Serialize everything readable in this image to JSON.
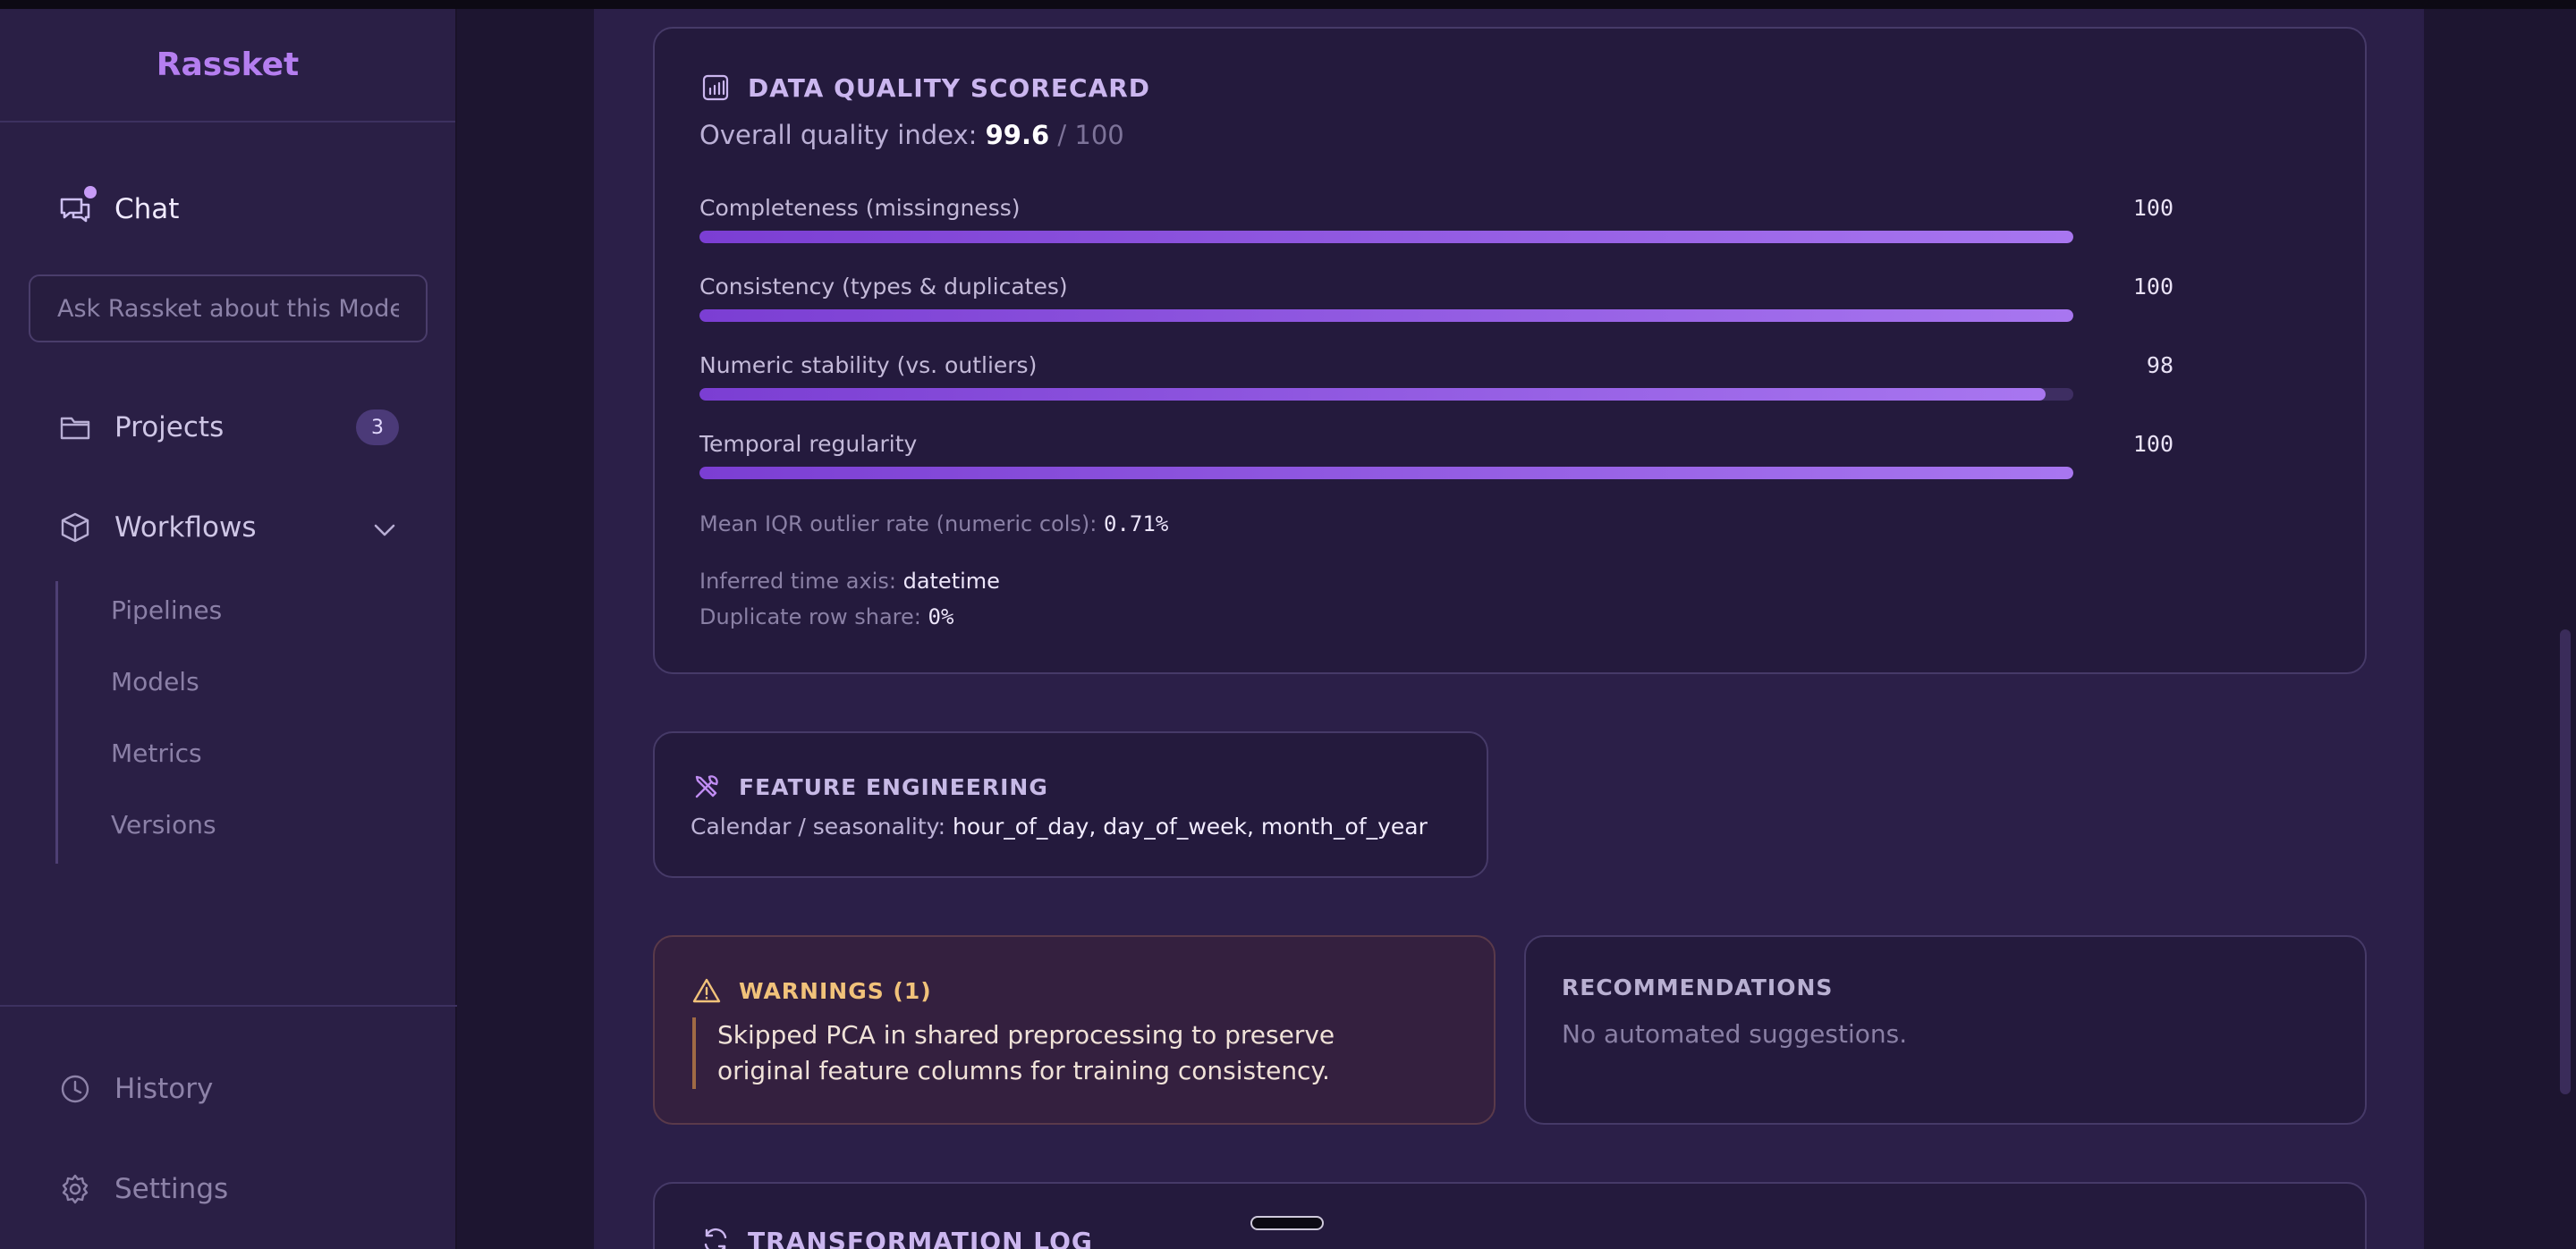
{
  "app": {
    "brand": "Rassket"
  },
  "sidebar": {
    "chat_label": "Chat",
    "ask_placeholder": "Ask Rassket about this Model",
    "projects_label": "Projects",
    "projects_count": "3",
    "workflows_label": "Workflows",
    "workflow_items": [
      "Pipelines",
      "Models",
      "Metrics",
      "Versions"
    ],
    "history_label": "History",
    "settings_label": "Settings"
  },
  "scorecard": {
    "title": "DATA QUALITY SCORECARD",
    "overall_prefix": "Overall quality index:",
    "overall_value": "99.6",
    "overall_suffix": "/ 100",
    "metrics": [
      {
        "label": "Completeness (missingness)",
        "value": "100",
        "fraction": 1.0
      },
      {
        "label": "Consistency (types & duplicates)",
        "value": "100",
        "fraction": 1.0
      },
      {
        "label": "Numeric stability (vs. outliers)",
        "value": "98",
        "fraction": 0.98
      },
      {
        "label": "Temporal regularity",
        "value": "100",
        "fraction": 1.0
      }
    ],
    "iqr_label": "Mean IQR outlier rate (numeric cols):",
    "iqr_value": "0.71%",
    "time_axis_label": "Inferred time axis:",
    "time_axis_value": "datetime",
    "dup_label": "Duplicate row share:",
    "dup_value": "0%"
  },
  "feature_engineering": {
    "title": "FEATURE ENGINEERING",
    "label": "Calendar / seasonality:",
    "value": "hour_of_day, day_of_week, month_of_year"
  },
  "warnings": {
    "title": "WARNINGS (1)",
    "text": "Skipped PCA in shared preprocessing to preserve original feature columns for training consistency."
  },
  "recommendations": {
    "title": "RECOMMENDATIONS",
    "text": "No automated suggestions."
  },
  "transformation_log": {
    "title": "TRANSFORMATION LOG"
  },
  "colors": {
    "accent": "#b57ef0",
    "bar_start": "#7b3ed3",
    "bar_end": "#a876f0",
    "warning": "#f1c27a"
  },
  "icons": [
    "chat-icon",
    "folder-icon",
    "cube-icon",
    "chevron-down-icon",
    "clock-icon",
    "gear-icon",
    "bar-chart-icon",
    "tools-icon",
    "warning-icon",
    "refresh-icon"
  ]
}
